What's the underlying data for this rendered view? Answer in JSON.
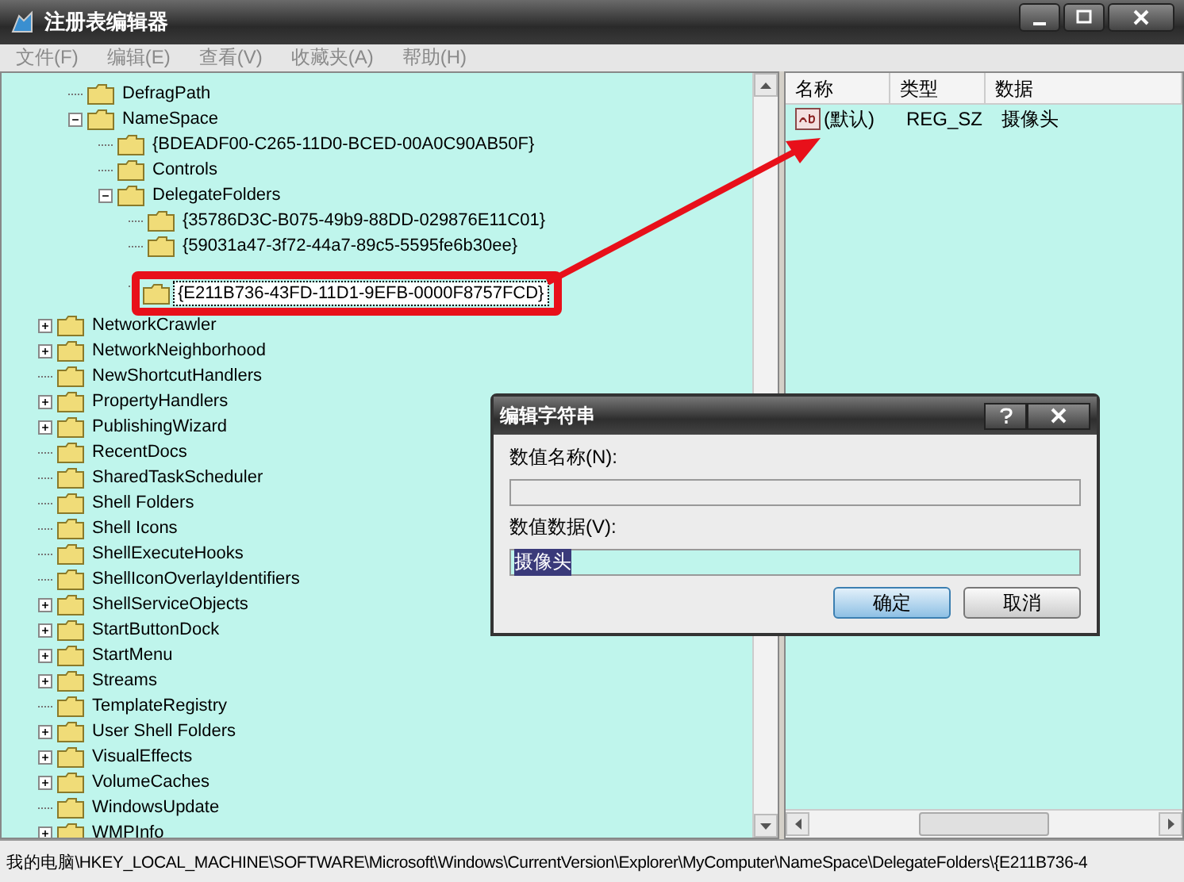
{
  "window": {
    "title": "注册表编辑器"
  },
  "menu": [
    "文件(F)",
    "编辑(E)",
    "查看(V)",
    "收藏夹(A)",
    "帮助(H)"
  ],
  "tree": {
    "scrolled_parent_children": [
      {
        "label": "DefragPath",
        "kind": "leaf",
        "selected": false,
        "annotated": false
      },
      {
        "label": "NameSpace",
        "kind": "expanded",
        "selected": false,
        "annotated": false,
        "children": [
          {
            "label": "{BDEADF00-C265-11D0-BCED-00A0C90AB50F}",
            "kind": "leaf",
            "selected": false,
            "annotated": false
          },
          {
            "label": "Controls",
            "kind": "leaf",
            "selected": false,
            "annotated": false
          },
          {
            "label": "DelegateFolders",
            "kind": "expanded",
            "selected": false,
            "annotated": false,
            "children": [
              {
                "label": "{35786D3C-B075-49b9-88DD-029876E11C01}",
                "kind": "leaf",
                "selected": false,
                "annotated": false
              },
              {
                "label": "{59031a47-3f72-44a7-89c5-5595fe6b30ee}",
                "kind": "leaf",
                "selected": false,
                "annotated": false
              },
              {
                "label": "{E211B736-43FD-11D1-9EFB-0000F8757FCD}",
                "kind": "leaf",
                "selected": true,
                "annotated": true
              }
            ]
          }
        ]
      }
    ],
    "items": [
      {
        "label": "NetworkCrawler",
        "kind": "collapsed",
        "selected": false,
        "annotated": false
      },
      {
        "label": "NetworkNeighborhood",
        "kind": "collapsed",
        "selected": false,
        "annotated": false
      },
      {
        "label": "NewShortcutHandlers",
        "kind": "leaf",
        "selected": false,
        "annotated": false
      },
      {
        "label": "PropertyHandlers",
        "kind": "collapsed",
        "selected": false,
        "annotated": false
      },
      {
        "label": "PublishingWizard",
        "kind": "collapsed",
        "selected": false,
        "annotated": false
      },
      {
        "label": "RecentDocs",
        "kind": "leaf",
        "selected": false,
        "annotated": false
      },
      {
        "label": "SharedTaskScheduler",
        "kind": "leaf",
        "selected": false,
        "annotated": false
      },
      {
        "label": "Shell Folders",
        "kind": "leaf",
        "selected": false,
        "annotated": false
      },
      {
        "label": "Shell Icons",
        "kind": "leaf",
        "selected": false,
        "annotated": false
      },
      {
        "label": "ShellExecuteHooks",
        "kind": "leaf",
        "selected": false,
        "annotated": false
      },
      {
        "label": "ShellIconOverlayIdentifiers",
        "kind": "leaf",
        "selected": false,
        "annotated": false
      },
      {
        "label": "ShellServiceObjects",
        "kind": "collapsed",
        "selected": false,
        "annotated": false
      },
      {
        "label": "StartButtonDock",
        "kind": "collapsed",
        "selected": false,
        "annotated": false
      },
      {
        "label": "StartMenu",
        "kind": "collapsed",
        "selected": false,
        "annotated": false
      },
      {
        "label": "Streams",
        "kind": "collapsed",
        "selected": false,
        "annotated": false
      },
      {
        "label": "TemplateRegistry",
        "kind": "leaf",
        "selected": false,
        "annotated": false
      },
      {
        "label": "User Shell Folders",
        "kind": "collapsed",
        "selected": false,
        "annotated": false
      },
      {
        "label": "VisualEffects",
        "kind": "collapsed",
        "selected": false,
        "annotated": false
      },
      {
        "label": "VolumeCaches",
        "kind": "collapsed",
        "selected": false,
        "annotated": false
      },
      {
        "label": "WindowsUpdate",
        "kind": "leaf",
        "selected": false,
        "annotated": false
      },
      {
        "label": "WMPInfo",
        "kind": "collapsed",
        "selected": false,
        "annotated": false
      }
    ]
  },
  "values": {
    "columns": [
      "名称",
      "类型",
      "数据"
    ],
    "rows": [
      {
        "name": "(默认)",
        "type": "REG_SZ",
        "data": "摄像头"
      }
    ]
  },
  "dialog": {
    "title": "编辑字符串",
    "name_label": "数值名称(N):",
    "data_label": "数值数据(V):",
    "data_field": {
      "value": "摄像头"
    },
    "buttons": [
      {
        "label": "确定",
        "default": true
      },
      {
        "label": "取消",
        "default": false
      }
    ]
  },
  "status_bar": "我的电脑\\HKEY_LOCAL_MACHINE\\SOFTWARE\\Microsoft\\Windows\\CurrentVersion\\Explorer\\MyComputer\\NameSpace\\DelegateFolders\\{E211B736-4"
}
